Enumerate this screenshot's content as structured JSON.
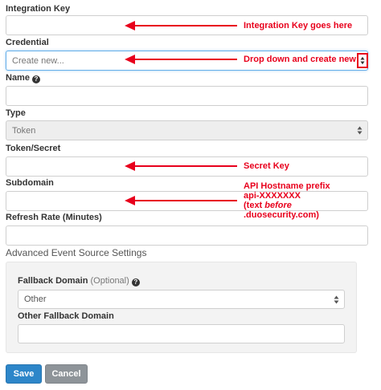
{
  "fields": {
    "integration_key": {
      "label": "Integration Key",
      "value": ""
    },
    "credential": {
      "label": "Credential",
      "placeholder": "Create new..."
    },
    "name": {
      "label": "Name",
      "value": ""
    },
    "type": {
      "label": "Type",
      "value": "Token"
    },
    "token_secret": {
      "label": "Token/Secret",
      "value": ""
    },
    "subdomain": {
      "label": "Subdomain",
      "value": ""
    },
    "refresh_rate": {
      "label": "Refresh Rate (Minutes)",
      "value": ""
    }
  },
  "advanced": {
    "title": "Advanced Event Source Settings",
    "fallback_domain": {
      "label": "Fallback Domain",
      "optional": "(Optional)",
      "value": "Other"
    },
    "other_fallback": {
      "label": "Other Fallback Domain",
      "value": ""
    }
  },
  "buttons": {
    "save": "Save",
    "cancel": "Cancel"
  },
  "annotations": {
    "integration_key": "Integration Key goes here",
    "credential": "Drop down and create new",
    "secret": "Secret Key",
    "subdomain_lines": [
      "API Hostname prefix",
      "api-XXXXXXX",
      "(text ",
      "before",
      ".duosecurity.com)"
    ]
  },
  "colors": {
    "annotation": "#e8001c",
    "save_button": "#2d86c9",
    "cancel_button": "#8e9499",
    "focus_border": "#66afe9"
  },
  "icons": {
    "help": "question-circle-icon",
    "select": "sort-caret-icon",
    "arrow": "arrow-left-icon"
  }
}
